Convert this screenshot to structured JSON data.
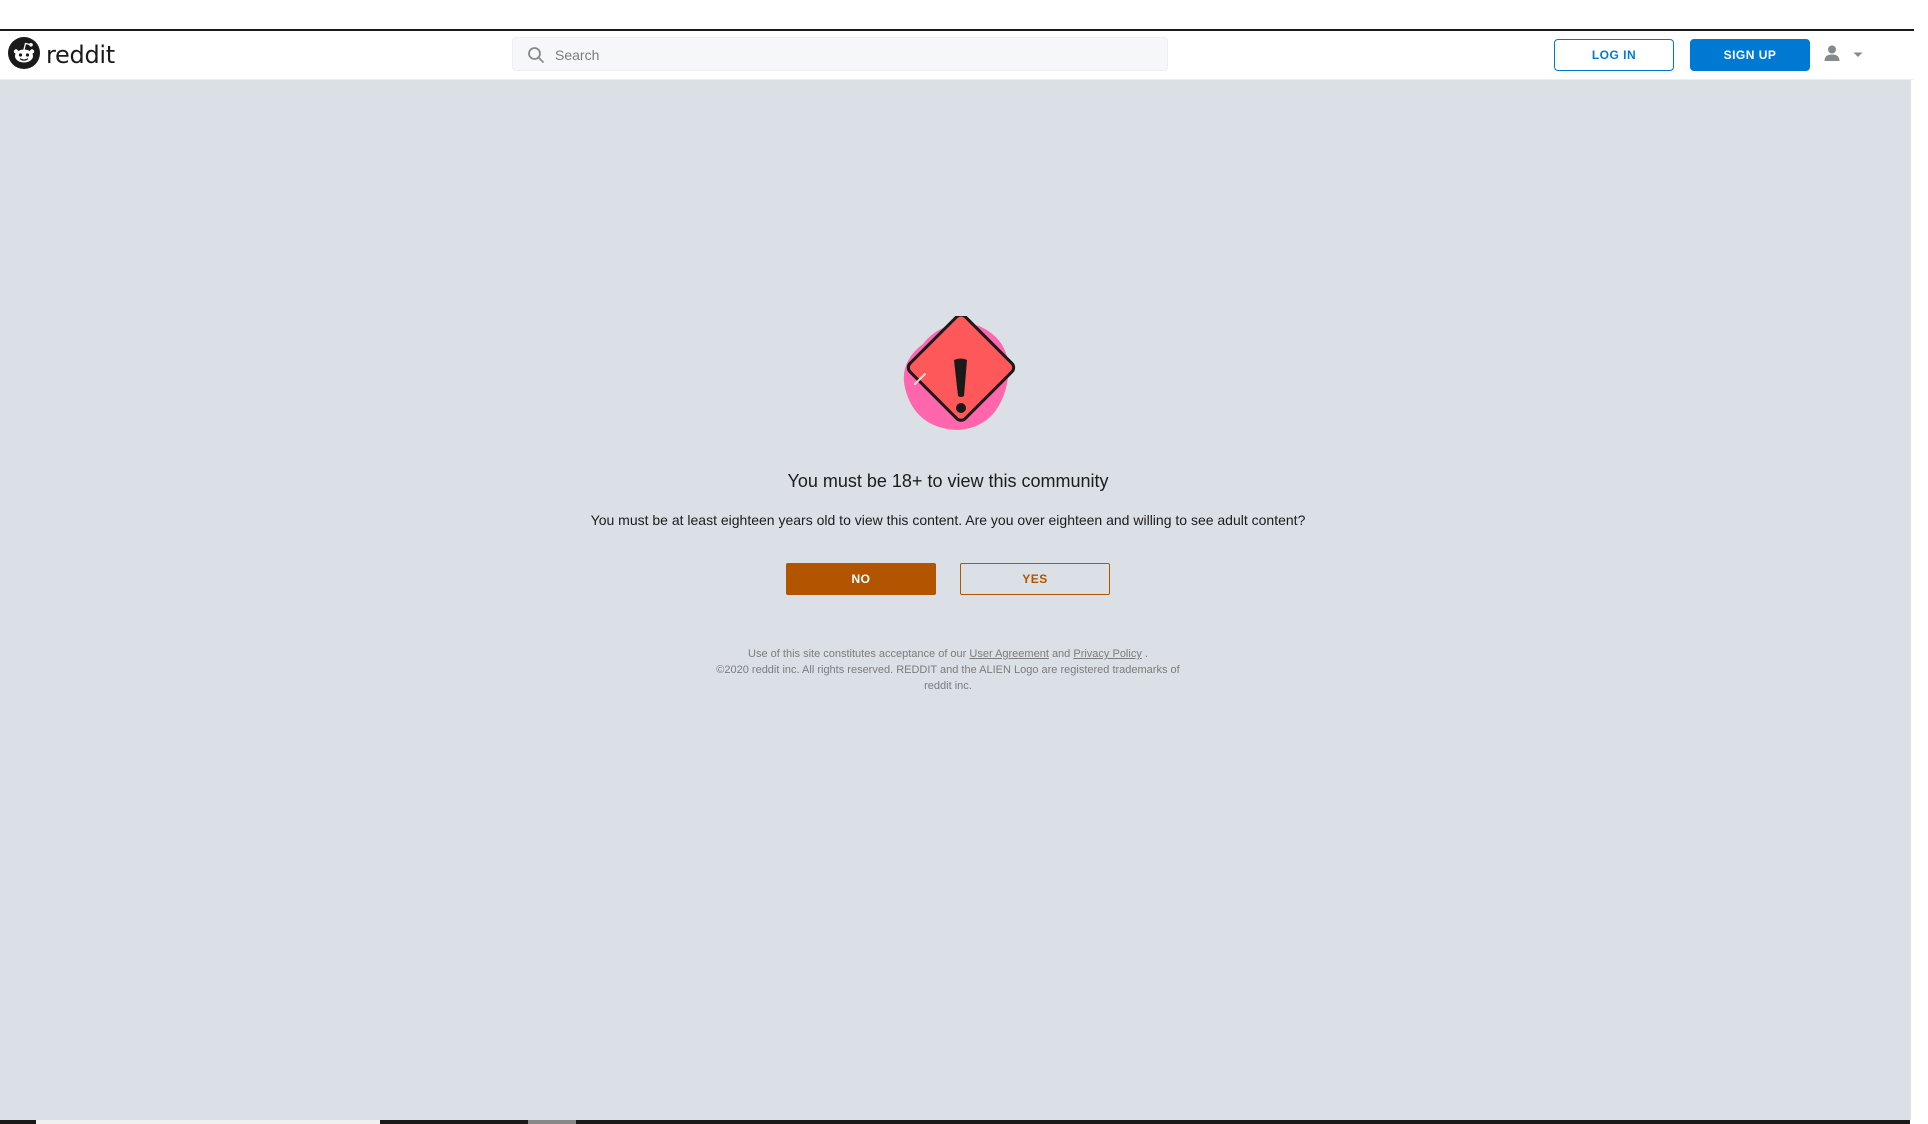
{
  "header": {
    "logo_text": "reddit",
    "search_placeholder": "Search",
    "login_label": "LOG IN",
    "signup_label": "SIGN UP"
  },
  "gate": {
    "title": "You must be 18+ to view this community",
    "description": "You must be at least eighteen years old to view this content. Are you over eighteen and willing to see adult content?",
    "no_label": "NO",
    "yes_label": "YES"
  },
  "legal": {
    "prefix": "Use of this site constitutes acceptance of our",
    "user_agreement": "User Agreement",
    "and": "and",
    "privacy_policy": "Privacy Policy",
    "period": ".",
    "copyright": "©2020 reddit inc. All rights reserved. REDDIT and the ALIEN Logo are registered trademarks of reddit inc."
  },
  "colors": {
    "brand_blue": "#0079d3",
    "nsfw_orange": "#b35400",
    "background": "#dae0e6",
    "warning_red": "#ff585b",
    "warning_pink": "#ff66ac"
  },
  "icons": [
    "reddit-alien-icon",
    "search-icon",
    "user-icon",
    "chevron-down-icon",
    "warning-diamond-icon"
  ]
}
